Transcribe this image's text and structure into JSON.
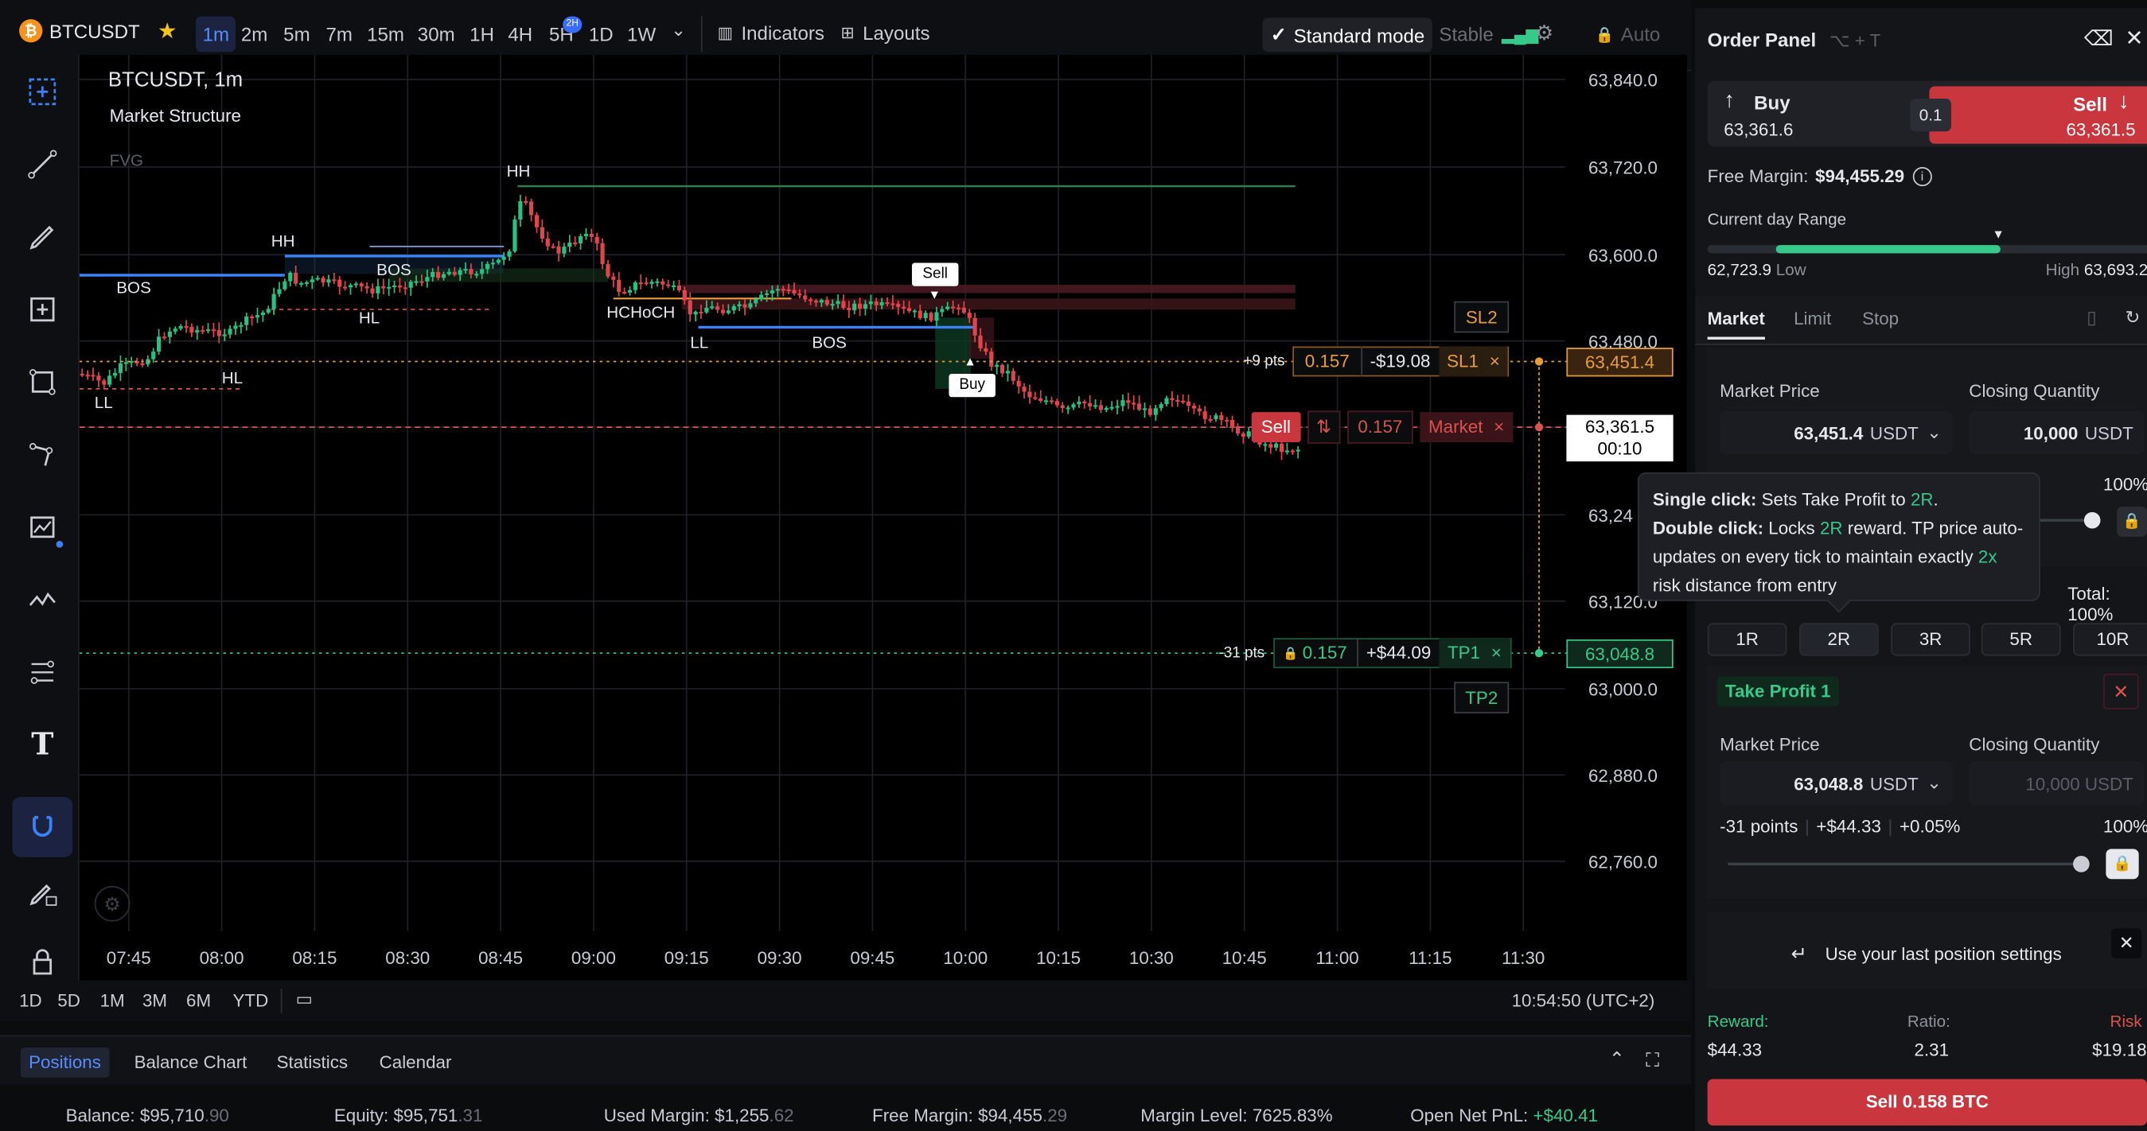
{
  "topbar": {
    "symbol": "BTCUSDT",
    "timeframes": [
      "1m",
      "2m",
      "5m",
      "7m",
      "15m",
      "30m",
      "1H",
      "4H",
      "5H",
      "1D",
      "1W"
    ],
    "active_timeframe": "1m",
    "badge": "2H",
    "indicators_label": "Indicators",
    "layouts_label": "Layouts",
    "standard_mode_label": "Standard mode",
    "stable_label": "Stable",
    "auto_label": "Auto"
  },
  "chart": {
    "title": "BTCUSDT, 1m",
    "indicator_name": "Market Structure",
    "fvg_label": "FVG",
    "price_ticks": [
      "63,840.0",
      "63,720.0",
      "63,600.0",
      "63,480.0",
      "63,24",
      "63,120.0",
      "63,000.0",
      "62,880.0",
      "62,760.0"
    ],
    "time_ticks": [
      "07:45",
      "08:00",
      "08:15",
      "08:30",
      "08:45",
      "09:00",
      "09:15",
      "09:30",
      "09:45",
      "10:00",
      "10:15",
      "10:30",
      "10:45",
      "11:00",
      "11:15",
      "11:30"
    ],
    "structure_labels": {
      "bos1": "BOS",
      "ll1": "LL",
      "hl1": "HL",
      "hh1": "HH",
      "bos2": "BOS",
      "hl2": "HL",
      "hh2": "HH",
      "hchoch": "HCHoCH",
      "ll2": "LL",
      "bos3": "BOS"
    },
    "sell_marker": "Sell",
    "buy_marker": "Buy",
    "sl2_label": "SL2",
    "tp2_label": "TP2",
    "sl1": {
      "pts": "+9 pts",
      "qty": "0.157",
      "pnl": "-$19.08",
      "label": "SL1",
      "close": "×",
      "price": "63,451.4"
    },
    "current": {
      "side": "Sell",
      "qty": "0.157",
      "type": "Market",
      "close": "×",
      "price": "63,361.5",
      "countdown": "00:10"
    },
    "tp1": {
      "pts": "-31 pts",
      "qty": "0.157",
      "pnl": "+$44.09",
      "label": "TP1",
      "close": "×",
      "price": "63,048.8"
    }
  },
  "bottombar": {
    "ranges": [
      "1D",
      "5D",
      "1M",
      "3M",
      "6M",
      "YTD"
    ],
    "clock": "10:54:50 (UTC+2)"
  },
  "tabs": {
    "items": [
      "Positions",
      "Balance Chart",
      "Statistics",
      "Calendar"
    ],
    "active": "Positions"
  },
  "status": {
    "balance_label": "Balance:",
    "balance": "$95,710",
    "balance_dec": ".90",
    "equity_label": "Equity:",
    "equity": "$95,751",
    "equity_dec": ".31",
    "used_label": "Used Margin:",
    "used": "$1,255",
    "used_dec": ".62",
    "free_label": "Free Margin:",
    "free": "$94,455",
    "free_dec": ".29",
    "level_label": "Margin Level:",
    "level": "7625.83%",
    "pnl_label": "Open Net PnL:",
    "pnl": "+$40.41"
  },
  "panel": {
    "title": "Order Panel",
    "shortcut": "⌥ + T",
    "buy_label": "Buy",
    "buy_price": "63,361.6",
    "spread": "0.1",
    "sell_label": "Sell",
    "sell_price": "63,361.5",
    "free_margin_label": "Free Margin:",
    "free_margin": "$94,455.29",
    "range_label": "Current day Range",
    "range_low": "62,723.9",
    "low_word": "Low",
    "high_word": "High",
    "range_high": "63,693.2",
    "order_tabs": [
      "Market",
      "Limit",
      "Stop"
    ],
    "sl": {
      "market_price_label": "Market Price",
      "closing_qty_label": "Closing Quantity",
      "price": "63,451.4",
      "unit": "USDT",
      "qty": "10,000",
      "qty_unit": "USDT",
      "pct": "100%",
      "total": "Total: 100%"
    },
    "tooltip": {
      "single_b": "Single click:",
      "single_t": " Sets Take Profit to ",
      "single_r": "2R",
      "single_end": ".",
      "double_b": "Double click:",
      "double_t": " Locks ",
      "double_r": "2R",
      "double_t2": " reward. TP price auto-updates on every tick to maintain exactly ",
      "double_x": "2x",
      "double_t3": " risk distance from entry"
    },
    "r_buttons": [
      "1R",
      "2R",
      "3R",
      "5R",
      "10R"
    ],
    "tp": {
      "title": "Take Profit 1",
      "market_price_label": "Market Price",
      "closing_qty_label": "Closing Quantity",
      "price": "63,048.8",
      "unit": "USDT",
      "qty": "10,000 USDT",
      "points": "-31 points",
      "pnl": "+$44.33",
      "pct_change": "+0.05%",
      "pct": "100%"
    },
    "last_settings": "Use your last position settings",
    "reward_label": "Reward:",
    "reward": "$44.33",
    "ratio_label": "Ratio:",
    "ratio": "2.31",
    "risk_label": "Risk",
    "risk": "$19.18",
    "submit": "Sell 0.158 BTC"
  }
}
